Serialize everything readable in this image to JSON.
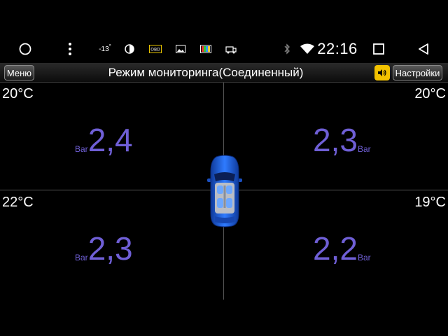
{
  "statusbar": {
    "outside_temp": "-13",
    "temp_degree": "°",
    "clock": "22:16",
    "icons": [
      "home-circle-icon",
      "menu-dots-icon",
      "brightness-icon",
      "obd-icon",
      "image-icon",
      "tv-icon",
      "car-service-icon",
      "bluetooth-icon",
      "wifi-icon",
      "recent-apps-icon",
      "back-icon"
    ]
  },
  "header": {
    "menu_label": "Меню",
    "title": "Режим мониторинга(Соединенный)",
    "settings_label": "Настройки",
    "sound_color": "#f2c200"
  },
  "tires": {
    "front_left": {
      "temp": "20°C",
      "pressure": "2,4",
      "unit": "Bar"
    },
    "front_right": {
      "temp": "20°C",
      "pressure": "2,3",
      "unit": "Bar"
    },
    "rear_left": {
      "temp": "22°C",
      "pressure": "2,3",
      "unit": "Bar"
    },
    "rear_right": {
      "temp": "19°C",
      "pressure": "2,2",
      "unit": "Bar"
    }
  },
  "colors": {
    "pressure": "#6f5fd6",
    "car": "#1e5bd8"
  }
}
